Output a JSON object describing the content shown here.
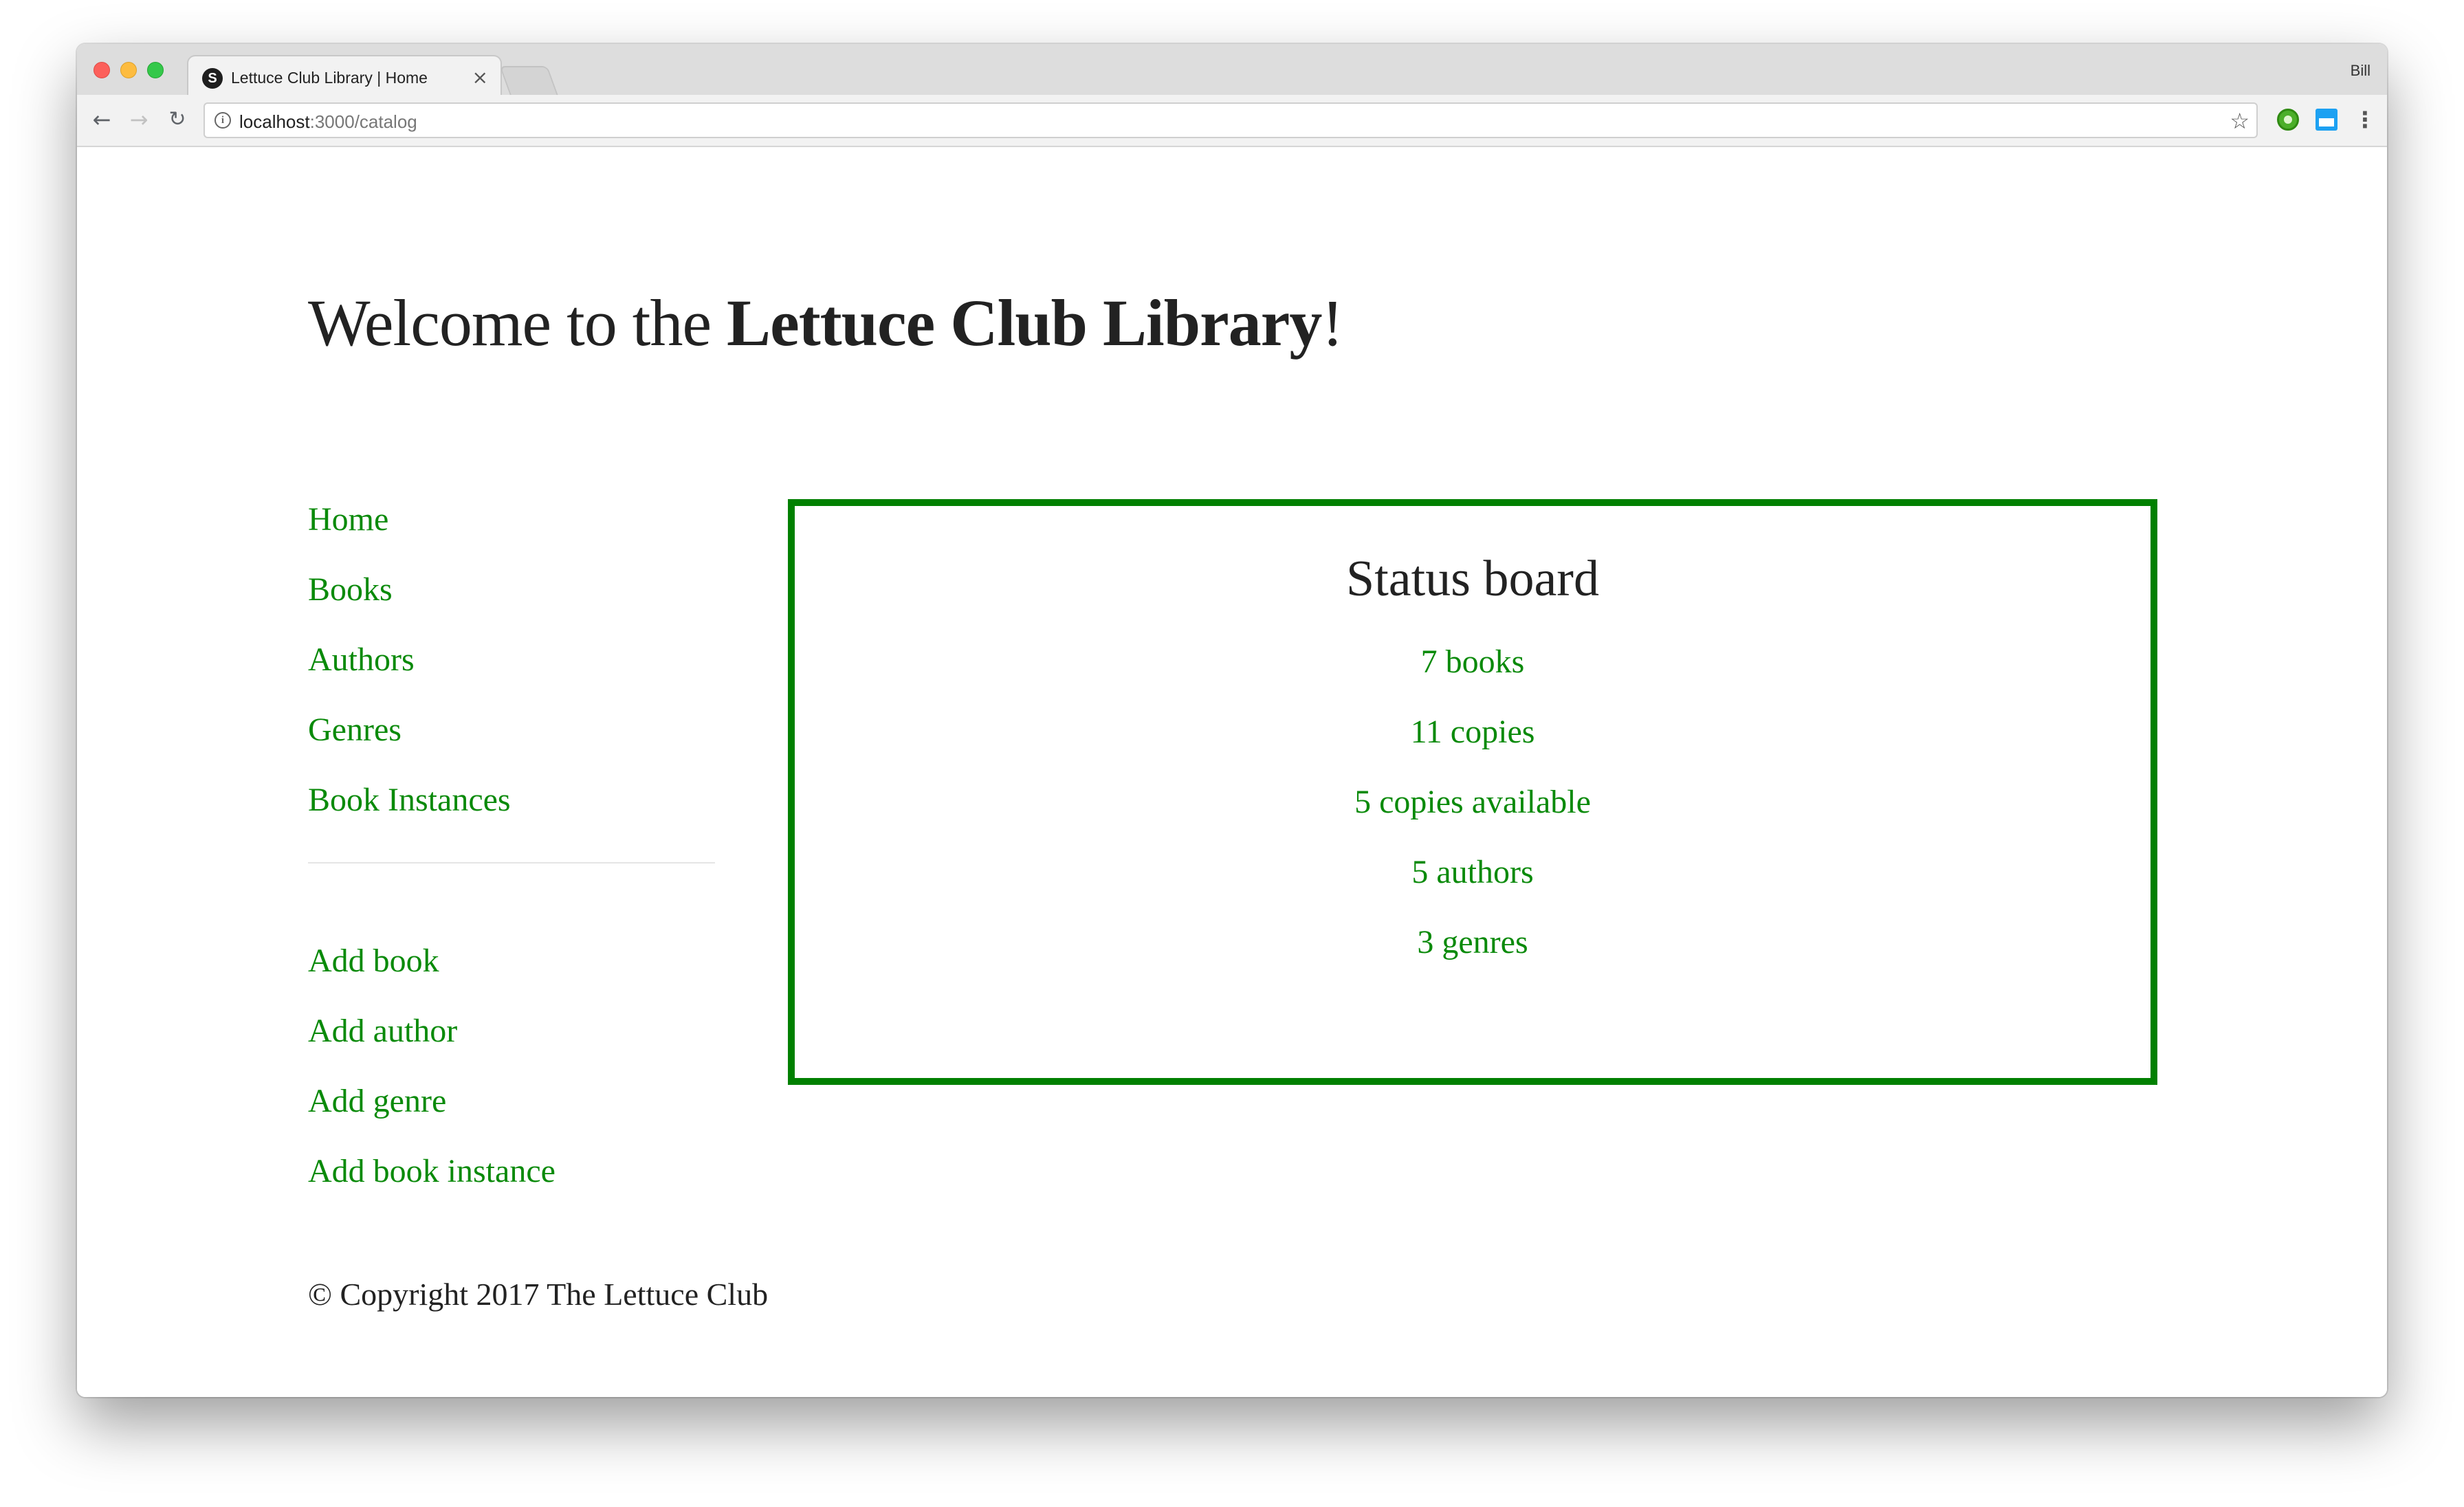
{
  "browser": {
    "tab": {
      "favicon_letter": "S",
      "title": "Lettuce Club Library | Home",
      "close": "×"
    },
    "profile_name": "Bill",
    "address_bar": {
      "host": "localhost",
      "path": ":3000/catalog"
    },
    "icons": {
      "back": "←",
      "forward": "→",
      "reload": "↻",
      "info": "i",
      "star": "☆",
      "menu": "⋮"
    }
  },
  "page": {
    "title_prefix": "Welcome to the ",
    "title_bold": "Lettuce Club Library",
    "title_suffix": "!",
    "sidebar": {
      "links": [
        "Home",
        "Books",
        "Authors",
        "Genres",
        "Book Instances"
      ],
      "admin_links": [
        "Add book",
        "Add author",
        "Add genre",
        "Add book instance"
      ]
    },
    "status_board": {
      "title": "Status board",
      "items": [
        "7 books",
        "11 copies",
        "5 copies available",
        "5 authors",
        "3 genres"
      ]
    },
    "footer": "© Copyright 2017 The Lettuce Club"
  },
  "colors": {
    "link": "#0a8a0a",
    "board_border": "#008000",
    "text": "#222222"
  }
}
